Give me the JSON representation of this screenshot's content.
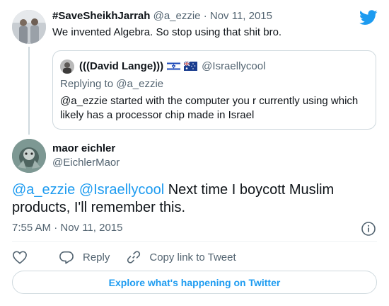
{
  "parent": {
    "name": "#SaveSheikhJarrah",
    "handle": "@a_ezzie",
    "separator": "·",
    "date": "Nov 11, 2015",
    "text": "We invented Algebra. So stop using that shit bro."
  },
  "quote": {
    "name": "(((David Lange)))",
    "flags": [
      "israel-flag-icon",
      "australia-flag-icon"
    ],
    "handle": "@Israellycool",
    "replying": "Replying to @a_ezzie",
    "text": "@a_ezzie started with the computer you r currently using which likely has a processor chip made in Israel"
  },
  "tweet": {
    "name": "maor eichler",
    "handle": "@EichlerMaor",
    "mention1": "@a_ezzie",
    "mention2": "@Israellycool",
    "text_rest": " Next time I boycott Muslim products, I'll remember this.",
    "time": "7:55 AM · Nov 11, 2015"
  },
  "actions": {
    "reply_label": "Reply",
    "copy_label": "Copy link to Tweet"
  },
  "explore_label": "Explore what's happening on Twitter",
  "colors": {
    "accent": "#1d9bf0",
    "muted": "#536471",
    "border": "#cfd9de"
  },
  "icons": [
    "twitter-bird-icon",
    "info-icon",
    "heart-icon",
    "reply-icon",
    "link-icon"
  ]
}
